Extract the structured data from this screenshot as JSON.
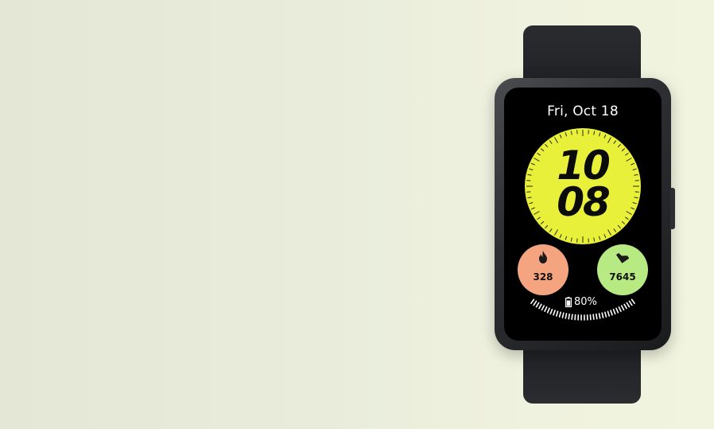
{
  "watch": {
    "date": "Fri, Oct 18",
    "time_hour": "10",
    "time_minute": "08",
    "calories": "328",
    "steps": "7645",
    "battery": "80%",
    "icons": [
      "flame-icon",
      "shoe-icon",
      "battery-icon"
    ]
  },
  "colors": {
    "dial": "#e8f03a",
    "calories_bubble": "#f4a57f",
    "steps_bubble": "#b7ea83",
    "background": "#eceedc"
  }
}
